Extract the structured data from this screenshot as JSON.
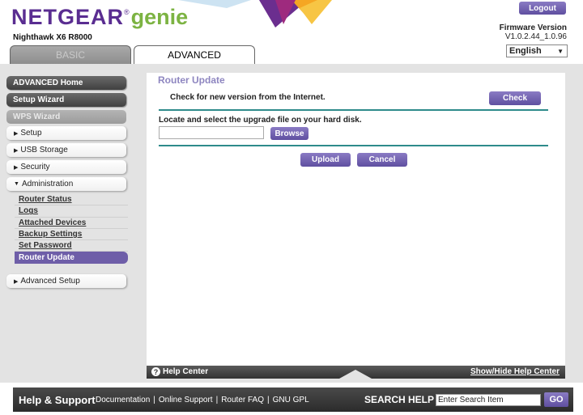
{
  "header": {
    "brand": "NETGEAR",
    "brand_suffix": "genie",
    "model": "Nighthawk X6 R8000",
    "logout_label": "Logout",
    "firmware_label": "Firmware Version",
    "firmware_value": "V1.0.2.44_1.0.96",
    "language": "English"
  },
  "tabs": {
    "basic": "BASIC",
    "advanced": "ADVANCED"
  },
  "sidebar": {
    "advanced_home": "ADVANCED Home",
    "setup_wizard": "Setup Wizard",
    "wps_wizard": "WPS Wizard",
    "setup": "Setup",
    "usb_storage": "USB Storage",
    "security": "Security",
    "administration": "Administration",
    "admin_items": [
      "Router Status",
      "Logs",
      "Attached Devices",
      "Backup Settings",
      "Set Password",
      "Router Update"
    ],
    "advanced_setup": "Advanced Setup"
  },
  "content": {
    "title": "Router Update",
    "check_text": "Check for new version from the Internet.",
    "check_button": "Check",
    "locate_text": "Locate and select the upgrade file on your hard disk.",
    "browse_button": "Browse",
    "upload_button": "Upload",
    "cancel_button": "Cancel"
  },
  "helpbar": {
    "help_center": "Help Center",
    "show_hide": "Show/Hide Help Center"
  },
  "footer": {
    "title": "Help & Support",
    "links": [
      "Documentation",
      "Online Support",
      "Router FAQ",
      "GNU GPL"
    ],
    "search_label": "SEARCH HELP",
    "search_value": "Enter Search Item",
    "go_button": "GO"
  },
  "colors": {
    "brand_purple": "#5a2d91",
    "genie_green": "#7cb342",
    "button_purple": "#6e5ea8",
    "divider_teal": "#2e8b8b"
  }
}
